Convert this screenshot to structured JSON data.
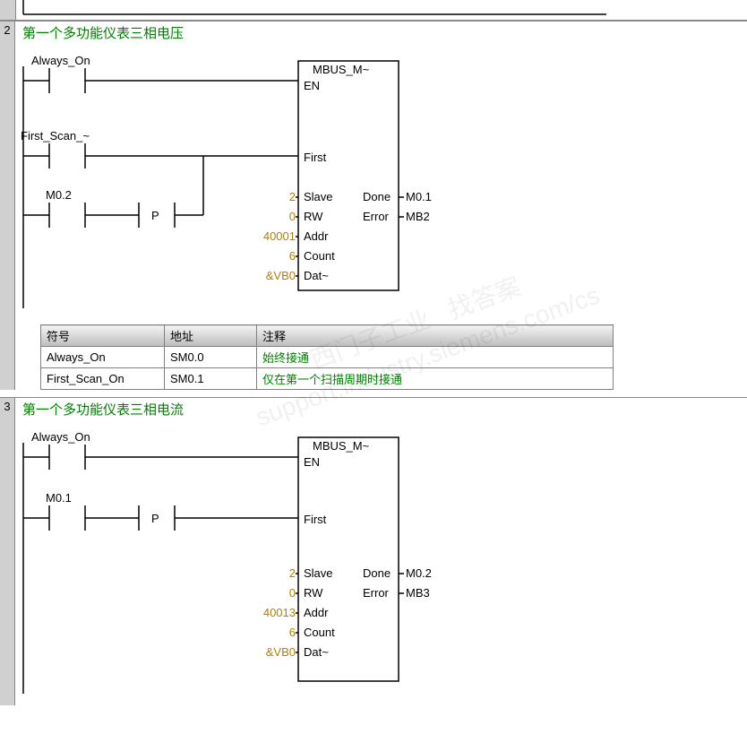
{
  "topFragment": {
    "alwaysLabel": "",
    "addrLabel": ""
  },
  "network2": {
    "number": "2",
    "title": "第一个多功能仪表三相电压",
    "contacts": {
      "alwaysOn": "Always_On",
      "firstScan": "First_Scan_~",
      "m02": "M0.2",
      "pulse": "P"
    },
    "block": {
      "name": "MBUS_M~",
      "ports": {
        "en": "EN",
        "first": "First",
        "slave": "Slave",
        "rw": "RW",
        "addr": "Addr",
        "count": "Count",
        "dat": "Dat~",
        "done": "Done",
        "error": "Error"
      },
      "inputs": {
        "slave": "2",
        "rw": "0",
        "addr": "40001",
        "count": "6",
        "dat": "&VB0"
      },
      "outputs": {
        "done": "M0.1",
        "error": "MB2"
      }
    },
    "symbolTable": {
      "headers": {
        "sym": "符号",
        "addr": "地址",
        "cmt": "注释"
      },
      "rows": [
        {
          "sym": "Always_On",
          "addr": "SM0.0",
          "cmt": "始终接通"
        },
        {
          "sym": "First_Scan_On",
          "addr": "SM0.1",
          "cmt": "仅在第一个扫描周期时接通"
        }
      ]
    }
  },
  "network3": {
    "number": "3",
    "title": "第一个多功能仪表三相电流",
    "contacts": {
      "alwaysOn": "Always_On",
      "m01": "M0.1",
      "pulse": "P"
    },
    "block": {
      "name": "MBUS_M~",
      "ports": {
        "en": "EN",
        "first": "First",
        "slave": "Slave",
        "rw": "RW",
        "addr": "Addr",
        "count": "Count",
        "dat": "Dat~",
        "done": "Done",
        "error": "Error"
      },
      "inputs": {
        "slave": "2",
        "rw": "0",
        "addr": "40013",
        "count": "6",
        "dat": "&VB0"
      },
      "outputs": {
        "done": "M0.2",
        "error": "MB3"
      }
    }
  },
  "watermark": "西门子工业   找答案\nsupport.industry.siemens.com/cs",
  "chart_data": {
    "type": "diagram",
    "description": "Siemens S7-200 ladder-logic networks showing MBUS_MSG block calls",
    "networks": [
      {
        "id": 2,
        "title": "第一个多功能仪表三相电压",
        "en_rungs": [
          "Always_On"
        ],
        "first_rungs": [
          "First_Scan_On",
          "M0.2 (P edge)"
        ],
        "block": "MBUS_MSG",
        "inputs": {
          "Slave": 2,
          "RW": 0,
          "Addr": 40001,
          "Count": 6,
          "DataPtr": "&VB0"
        },
        "outputs": {
          "Done": "M0.1",
          "Error": "MB2"
        }
      },
      {
        "id": 3,
        "title": "第一个多功能仪表三相电流",
        "en_rungs": [
          "Always_On"
        ],
        "first_rungs": [
          "M0.1 (P edge)"
        ],
        "block": "MBUS_MSG",
        "inputs": {
          "Slave": 2,
          "RW": 0,
          "Addr": 40013,
          "Count": 6,
          "DataPtr": "&VB0"
        },
        "outputs": {
          "Done": "M0.2",
          "Error": "MB3"
        }
      }
    ]
  }
}
